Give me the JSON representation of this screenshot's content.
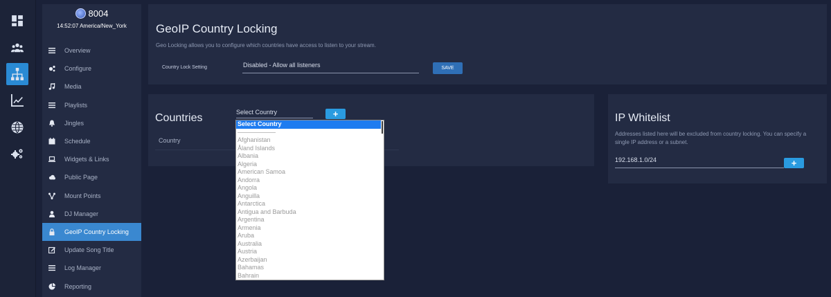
{
  "rail": {
    "items": [
      {
        "icon": "dashboard-icon",
        "active": false
      },
      {
        "icon": "users-icon",
        "active": false
      },
      {
        "icon": "sitemap-icon",
        "active": true
      },
      {
        "icon": "chart-icon",
        "active": false
      },
      {
        "icon": "globe-icon",
        "active": false
      },
      {
        "icon": "cogs-icon",
        "active": false
      }
    ]
  },
  "station": {
    "name": "8004",
    "time": "14:52:07 America/New_York"
  },
  "nav": {
    "items": [
      {
        "label": "Overview",
        "icon": "list-icon"
      },
      {
        "label": "Configure",
        "icon": "cogs-icon"
      },
      {
        "label": "Media",
        "icon": "music-icon"
      },
      {
        "label": "Playlists",
        "icon": "list-icon"
      },
      {
        "label": "Jingles",
        "icon": "bell-icon"
      },
      {
        "label": "Schedule",
        "icon": "calendar-icon"
      },
      {
        "label": "Widgets & Links",
        "icon": "laptop-icon"
      },
      {
        "label": "Public Page",
        "icon": "cloud-icon"
      },
      {
        "label": "Mount Points",
        "icon": "sitemap-icon"
      },
      {
        "label": "DJ Manager",
        "icon": "user-icon"
      },
      {
        "label": "GeoIP Country Locking",
        "icon": "lock-icon",
        "active": true
      },
      {
        "label": "Update Song Title",
        "icon": "edit-icon"
      },
      {
        "label": "Log Manager",
        "icon": "list-icon"
      },
      {
        "label": "Reporting",
        "icon": "pie-icon"
      }
    ]
  },
  "geo": {
    "title": "GeoIP Country Locking",
    "description": "Geo Locking allows you to configure which countries have access to listen to your stream.",
    "lock_label": "Country Lock Setting",
    "lock_value": "Disabled - Allow all listeners",
    "save_label": "SAVE"
  },
  "countries": {
    "title": "Countries",
    "select_label": "Select Country",
    "add_label": "+",
    "column_header": "Country"
  },
  "dropdown": {
    "selected": "Select Country",
    "options": [
      "Afghanistan",
      "Åland Islands",
      "Albania",
      "Algeria",
      "American Samoa",
      "Andorra",
      "Angola",
      "Anguilla",
      "Antarctica",
      "Antigua and Barbuda",
      "Argentina",
      "Armenia",
      "Aruba",
      "Australia",
      "Austria",
      "Azerbaijan",
      "Bahamas",
      "Bahrain"
    ]
  },
  "ip": {
    "title": "IP Whitelist",
    "description": "Addresses listed here will be excluded from country locking. You can specify a single IP address or a subnet.",
    "value": "192.168.1.0/24",
    "add_label": "+"
  },
  "colors": {
    "background": "#1a2138",
    "panel": "#232b43",
    "accent": "#2a8ad4",
    "nav_active": "#3a88d0",
    "dropdown_selected": "#1e7cf0"
  }
}
